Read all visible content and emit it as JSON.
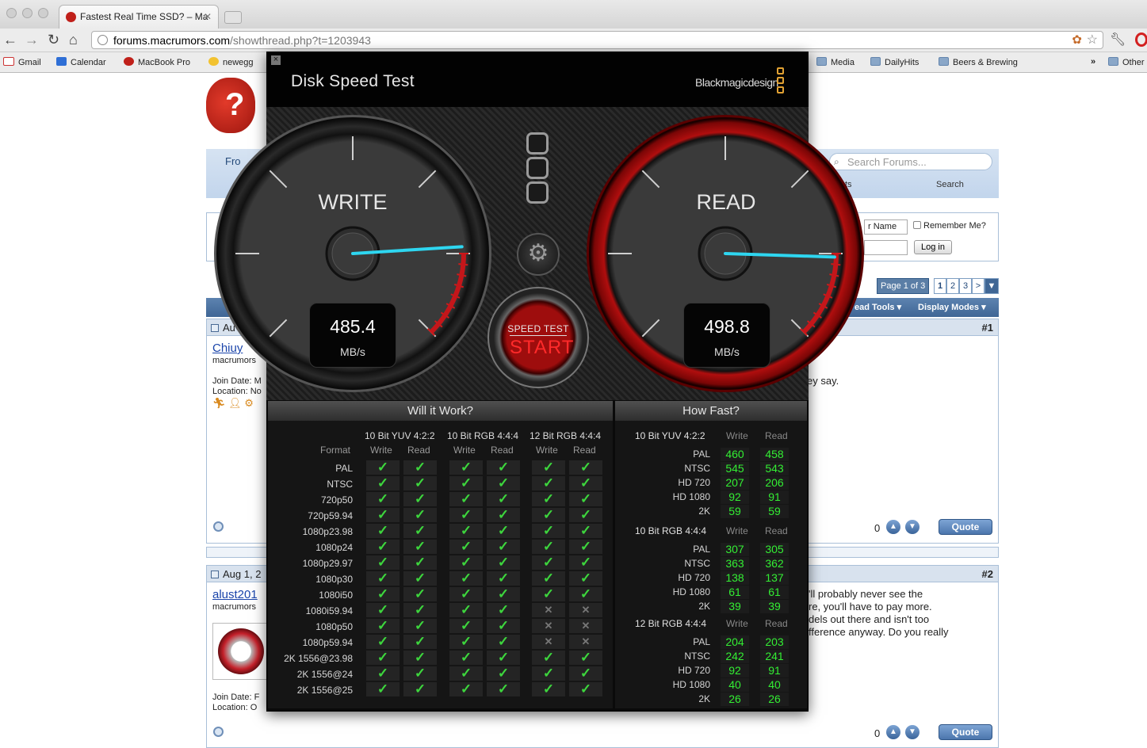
{
  "browser": {
    "tab_title": "Fastest Real Time SSD? – Ma",
    "url_domain": "forums.macrumors.com",
    "url_path": "/showthread.php?t=1203943",
    "bookmarks": [
      {
        "label": "Gmail",
        "icon": "gmail-icon"
      },
      {
        "label": "Calendar",
        "icon": "calendar-icon"
      },
      {
        "label": "MacBook Pro",
        "icon": "macrumors-icon"
      },
      {
        "label": "newegg",
        "icon": "newegg-icon"
      },
      {
        "label": "Media",
        "icon": "folder-icon"
      },
      {
        "label": "DailyHits",
        "icon": "folder-icon"
      },
      {
        "label": "Beers & Brewing",
        "icon": "folder-icon"
      },
      {
        "label": "»",
        "icon": ""
      },
      {
        "label": "Other",
        "icon": "folder-icon"
      }
    ]
  },
  "forum": {
    "nav_front": "Fro",
    "search_placeholder": "Search Forums...",
    "nav_search": "Search",
    "nav_partial": "ts",
    "username_placeholder": "r Name",
    "remember_me": "Remember Me?",
    "login_button": "Log in",
    "pager_label": "Page 1 of 3",
    "pages": [
      "1",
      "2",
      "3",
      ">"
    ],
    "thread_tools": "ead Tools",
    "display_modes": "Display Modes",
    "posts": [
      {
        "number": "#1",
        "date": "Au",
        "username": "Chiuy",
        "title": "macrumors",
        "join_date": "Join Date: M",
        "location": "Location: No",
        "body": "ey say.",
        "votes": "0",
        "quote": "Quote"
      },
      {
        "number": "#2",
        "date": "Aug 1, 2",
        "username": "alust201",
        "title": "macrumors",
        "join_date": "Join Date: F",
        "location": "Location: O",
        "body": "'ll probably never see the\nre, you'll have to pay more.\ndels out there and isn't too\nfference anyway. Do you really",
        "votes": "0",
        "quote": "Quote"
      }
    ]
  },
  "app": {
    "title": "Disk Speed Test",
    "brand": "Blackmagicdesign",
    "write_label": "WRITE",
    "read_label": "READ",
    "write_value": "485.4",
    "read_value": "498.8",
    "unit": "MB/s",
    "write_needle_fraction": 0.82,
    "read_needle_fraction": 0.84,
    "start_top": "SPEED TEST",
    "start_bottom": "START",
    "accent_red": "#ff2a2a",
    "check_green": "#3dd63d"
  },
  "will_it_work": {
    "heading": "Will it Work?",
    "format_header": "Format",
    "groups": [
      "10 Bit YUV 4:2:2",
      "10 Bit RGB 4:4:4",
      "12 Bit RGB 4:4:4"
    ],
    "sub_headers": [
      "Write",
      "Read"
    ],
    "rows": [
      {
        "format": "PAL",
        "cells": [
          1,
          1,
          1,
          1,
          1,
          1
        ]
      },
      {
        "format": "NTSC",
        "cells": [
          1,
          1,
          1,
          1,
          1,
          1
        ]
      },
      {
        "format": "720p50",
        "cells": [
          1,
          1,
          1,
          1,
          1,
          1
        ]
      },
      {
        "format": "720p59.94",
        "cells": [
          1,
          1,
          1,
          1,
          1,
          1
        ]
      },
      {
        "format": "1080p23.98",
        "cells": [
          1,
          1,
          1,
          1,
          1,
          1
        ]
      },
      {
        "format": "1080p24",
        "cells": [
          1,
          1,
          1,
          1,
          1,
          1
        ]
      },
      {
        "format": "1080p29.97",
        "cells": [
          1,
          1,
          1,
          1,
          1,
          1
        ]
      },
      {
        "format": "1080p30",
        "cells": [
          1,
          1,
          1,
          1,
          1,
          1
        ]
      },
      {
        "format": "1080i50",
        "cells": [
          1,
          1,
          1,
          1,
          1,
          1
        ]
      },
      {
        "format": "1080i59.94",
        "cells": [
          1,
          1,
          1,
          1,
          0,
          0
        ]
      },
      {
        "format": "1080p50",
        "cells": [
          1,
          1,
          1,
          1,
          0,
          0
        ]
      },
      {
        "format": "1080p59.94",
        "cells": [
          1,
          1,
          1,
          1,
          0,
          0
        ]
      },
      {
        "format": "2K 1556@23.98",
        "cells": [
          1,
          1,
          1,
          1,
          1,
          1
        ]
      },
      {
        "format": "2K 1556@24",
        "cells": [
          1,
          1,
          1,
          1,
          1,
          1
        ]
      },
      {
        "format": "2K 1556@25",
        "cells": [
          1,
          1,
          1,
          1,
          1,
          1
        ]
      }
    ]
  },
  "how_fast": {
    "heading": "How Fast?",
    "sub_headers": [
      "Write",
      "Read"
    ],
    "sections": [
      {
        "name": "10 Bit YUV 4:2:2",
        "rows": [
          {
            "label": "PAL",
            "write": "460",
            "read": "458"
          },
          {
            "label": "NTSC",
            "write": "545",
            "read": "543"
          },
          {
            "label": "HD 720",
            "write": "207",
            "read": "206"
          },
          {
            "label": "HD 1080",
            "write": "92",
            "read": "91"
          },
          {
            "label": "2K",
            "write": "59",
            "read": "59"
          }
        ]
      },
      {
        "name": "10 Bit RGB 4:4:4",
        "rows": [
          {
            "label": "PAL",
            "write": "307",
            "read": "305"
          },
          {
            "label": "NTSC",
            "write": "363",
            "read": "362"
          },
          {
            "label": "HD 720",
            "write": "138",
            "read": "137"
          },
          {
            "label": "HD 1080",
            "write": "61",
            "read": "61"
          },
          {
            "label": "2K",
            "write": "39",
            "read": "39"
          }
        ]
      },
      {
        "name": "12 Bit RGB 4:4:4",
        "rows": [
          {
            "label": "PAL",
            "write": "204",
            "read": "203"
          },
          {
            "label": "NTSC",
            "write": "242",
            "read": "241"
          },
          {
            "label": "HD 720",
            "write": "92",
            "read": "91"
          },
          {
            "label": "HD 1080",
            "write": "40",
            "read": "40"
          },
          {
            "label": "2K",
            "write": "26",
            "read": "26"
          }
        ]
      }
    ]
  }
}
